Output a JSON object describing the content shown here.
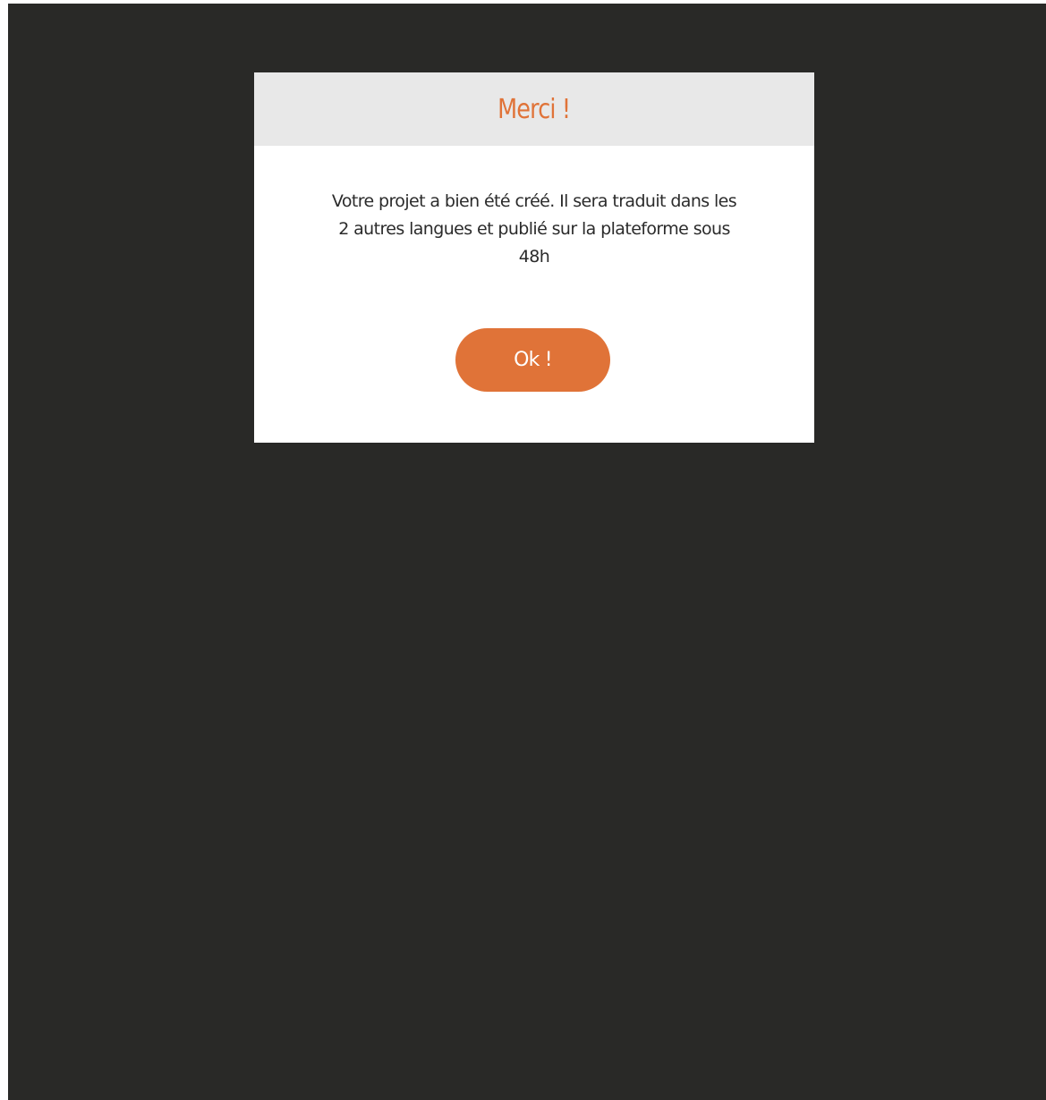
{
  "modal": {
    "title": "Merci !",
    "message": "Votre projet a bien été créé. Il sera traduit dans les 2 autres langues et publié sur la plateforme sous 48h",
    "ok_label": "Ok !"
  },
  "colors": {
    "overlay": "#292927",
    "header_bg": "#e8e8e8",
    "accent": "#e07338",
    "body_text": "#2b2b2b"
  }
}
